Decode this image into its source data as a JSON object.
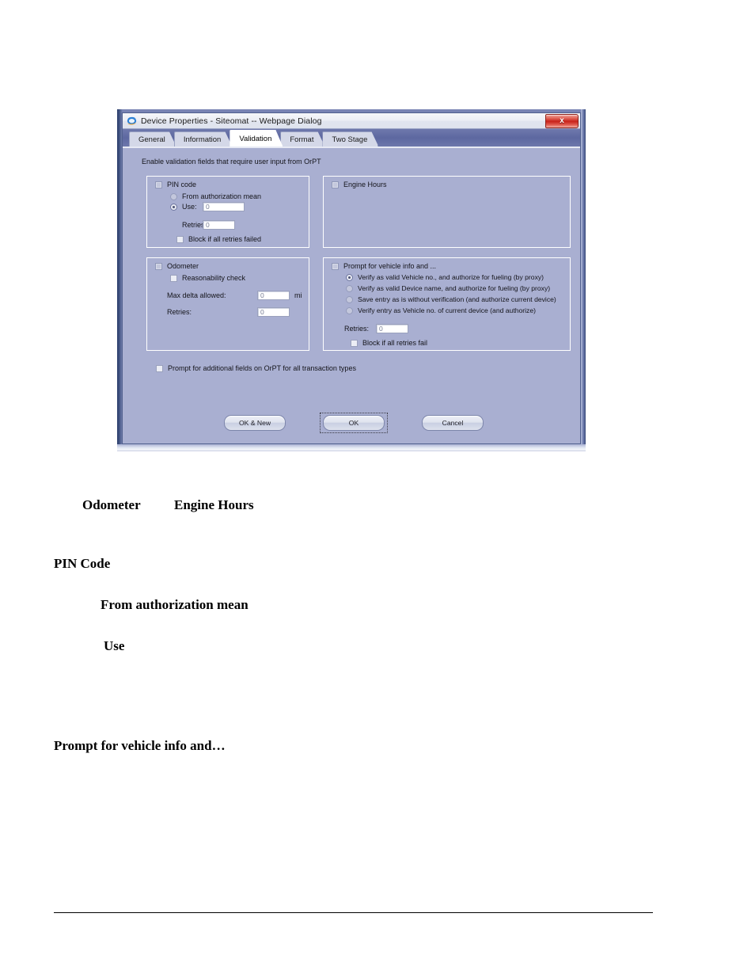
{
  "dialog": {
    "title": "Device Properties - Siteomat -- Webpage Dialog",
    "title_icon": "internet-explorer-icon",
    "close_label": "x",
    "tabs": [
      {
        "label": "General",
        "active": false
      },
      {
        "label": "Information",
        "active": false
      },
      {
        "label": "Validation",
        "active": true
      },
      {
        "label": "Format",
        "active": false
      },
      {
        "label": "Two Stage",
        "active": false
      }
    ],
    "intro_text": "Enable validation fields that require user input from OrPT",
    "groups": {
      "pin": {
        "checkbox_label": "PIN code",
        "checked": false,
        "radios": [
          {
            "label": "From authorization mean",
            "selected": false
          },
          {
            "label": "Use:",
            "selected": true
          }
        ],
        "use_value": "0",
        "retries_label": "Retries:",
        "retries_value": "0",
        "block_label": "Block if all retries failed",
        "block_checked": false
      },
      "engine_hours": {
        "checkbox_label": "Engine Hours",
        "checked": false
      },
      "odometer": {
        "checkbox_label": "Odometer",
        "checked": false,
        "reasonability_label": "Reasonability check",
        "reasonability_checked": false,
        "max_delta_label": "Max delta allowed:",
        "max_delta_value": "0",
        "max_delta_unit": "mi",
        "retries_label": "Retries:",
        "retries_value": "0"
      },
      "prompt_vehicle": {
        "checkbox_label": "Prompt for vehicle info and ...",
        "checked": false,
        "radios": [
          {
            "label": "Verify as valid Vehicle no., and authorize for fueling (by proxy)",
            "selected": true
          },
          {
            "label": "Verify as valid Device name, and authorize for fueling (by proxy)",
            "selected": false
          },
          {
            "label": "Save entry as is without verification (and authorize current device)",
            "selected": false
          },
          {
            "label": "Verify entry as Vehicle no. of current device (and authorize)",
            "selected": false
          }
        ],
        "retries_label": "Retries:",
        "retries_value": "0",
        "block_label": "Block if all retries fail",
        "block_checked": false
      }
    },
    "additional_fields": {
      "label": "Prompt for additional fields on OrPT for all transaction types",
      "checked": false
    },
    "buttons": {
      "ok_new": "OK & New",
      "ok": "OK",
      "cancel": "Cancel"
    }
  },
  "document": {
    "lines": [
      "Odometer",
      "Engine Hours",
      "PIN Code",
      "From authorization mean",
      "Use",
      "Prompt for vehicle info and…"
    ]
  },
  "colors": {
    "dialog_background": "#a9afd1",
    "tabstrip": "#5d68a0",
    "close_button": "#c8221a",
    "field_background": "#ffffff"
  }
}
